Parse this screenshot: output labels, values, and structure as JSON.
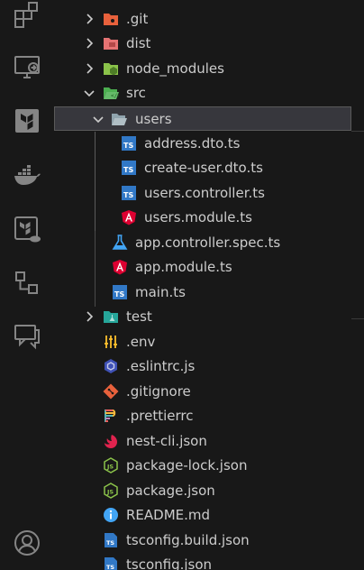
{
  "activity_bar": {
    "icons": [
      "extensions-icon",
      "remote-explorer-icon",
      "terraform-icon",
      "docker-icon",
      "terraform-cloud-icon",
      "source-tree-icon",
      "comments-icon",
      "account-icon"
    ]
  },
  "explorer": {
    "items": [
      {
        "name": ".git",
        "type": "folder",
        "expanded": false
      },
      {
        "name": "dist",
        "type": "folder",
        "expanded": false
      },
      {
        "name": "node_modules",
        "type": "folder",
        "expanded": false
      },
      {
        "name": "src",
        "type": "folder",
        "expanded": true
      },
      {
        "name": "users",
        "type": "folder",
        "expanded": true,
        "selected": true
      },
      {
        "name": "address.dto.ts",
        "type": "file",
        "icon": "typescript"
      },
      {
        "name": "create-user.dto.ts",
        "type": "file",
        "icon": "typescript"
      },
      {
        "name": "users.controller.ts",
        "type": "file",
        "icon": "typescript"
      },
      {
        "name": "users.module.ts",
        "type": "file",
        "icon": "angular"
      },
      {
        "name": "app.controller.spec.ts",
        "type": "file",
        "icon": "test"
      },
      {
        "name": "app.module.ts",
        "type": "file",
        "icon": "angular"
      },
      {
        "name": "main.ts",
        "type": "file",
        "icon": "typescript"
      },
      {
        "name": "test",
        "type": "folder",
        "expanded": false
      },
      {
        "name": ".env",
        "type": "file",
        "icon": "env"
      },
      {
        "name": ".eslintrc.js",
        "type": "file",
        "icon": "eslint"
      },
      {
        "name": ".gitignore",
        "type": "file",
        "icon": "git"
      },
      {
        "name": ".prettierrc",
        "type": "file",
        "icon": "prettier"
      },
      {
        "name": "nest-cli.json",
        "type": "file",
        "icon": "nest"
      },
      {
        "name": "package-lock.json",
        "type": "file",
        "icon": "node-json"
      },
      {
        "name": "package.json",
        "type": "file",
        "icon": "node-json"
      },
      {
        "name": "README.md",
        "type": "file",
        "icon": "info"
      },
      {
        "name": "tsconfig.build.json",
        "type": "file",
        "icon": "tsconfig"
      },
      {
        "name": "tsconfig.json",
        "type": "file",
        "icon": "tsconfig"
      }
    ]
  },
  "colors": {
    "background": "#181818",
    "selection": "#37373d",
    "typescript": "#3178c6",
    "angular": "#dd0031",
    "git": "#e8613c",
    "folder_green": "#8bc34a"
  }
}
